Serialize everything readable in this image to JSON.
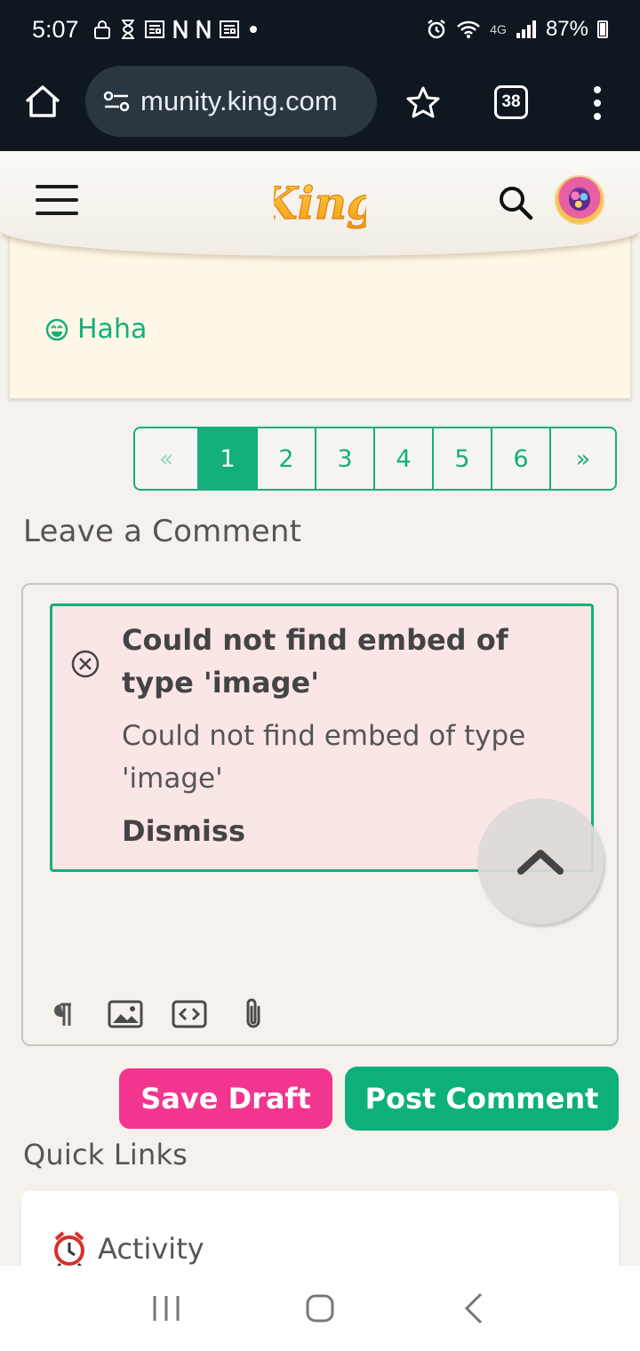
{
  "status_bar": {
    "time": "5:07",
    "network": "4G",
    "battery": "87%"
  },
  "browser": {
    "url": "munity.king.com",
    "tab_count": "38"
  },
  "site": {
    "logo_text": "King"
  },
  "reaction": {
    "label": "Haha"
  },
  "pagination": {
    "first": "«",
    "pages": [
      "1",
      "2",
      "3",
      "4",
      "5",
      "6"
    ],
    "last": "»",
    "active_page": "1"
  },
  "comment": {
    "section_title": "Leave a Comment",
    "error_title": "Could not find embed of type 'image'",
    "error_message": "Could not find embed of type 'image'",
    "dismiss_label": "Dismiss",
    "save_draft_label": "Save Draft",
    "post_comment_label": "Post Comment"
  },
  "quick_links": {
    "section_title": "Quick Links",
    "items": [
      {
        "label": "Activity",
        "icon": "alarm-clock-icon"
      }
    ]
  },
  "colors": {
    "accent_green": "#13b07c",
    "pink": "#f2358e",
    "status_bg": "#0f1720"
  }
}
